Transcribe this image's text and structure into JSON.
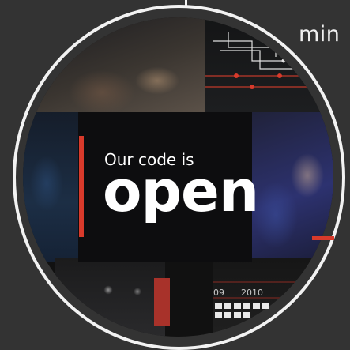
{
  "badge": {
    "small_title": "Our code is",
    "big_word": "open"
  },
  "corner_text": "min",
  "timeline": {
    "labels": [
      "09",
      "2010"
    ]
  },
  "colors": {
    "accent": "#d83a2b",
    "background": "#333333",
    "ring": "#f2f2f2",
    "text": "#ffffff"
  },
  "icons": {
    "circuit_graphic": "circuit-lines-icon"
  }
}
